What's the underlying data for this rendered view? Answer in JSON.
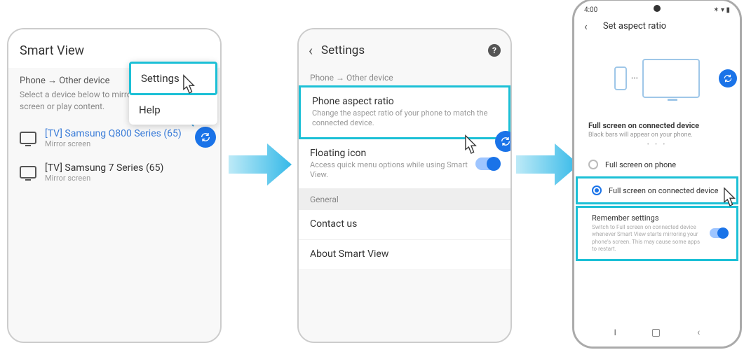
{
  "phone1": {
    "header": "Smart View",
    "menu": {
      "settings": "Settings",
      "help": "Help"
    },
    "section": "Phone → Other device",
    "description": "Select a device below to mirror your phone's screen or play content.",
    "devices": [
      {
        "name": "[TV] Samsung Q800 Series (65)",
        "sub": "Mirror screen"
      },
      {
        "name": "[TV] Samsung 7 Series (65)",
        "sub": "Mirror screen"
      }
    ]
  },
  "phone2": {
    "title": "Settings",
    "section1": "Phone → Other device",
    "aspect": {
      "title": "Phone aspect ratio",
      "desc": "Change the aspect ratio of your phone to match the connected device."
    },
    "floating": {
      "title": "Floating icon",
      "desc": "Access quick menu options while using Smart View."
    },
    "section2": "General",
    "contact": "Contact us",
    "about": "About Smart View"
  },
  "phone3": {
    "time": "4:00",
    "title": "Set aspect ratio",
    "info_title": "Full screen on connected device",
    "info_desc": "Black bars will appear on your phone.",
    "opt1": "Full screen on phone",
    "opt2": "Full screen on connected device",
    "remember": {
      "title": "Remember settings",
      "desc": "Switch to Full screen on connected device whenever Smart View starts mirroring your phone's screen. This may cause some apps to restart."
    }
  }
}
